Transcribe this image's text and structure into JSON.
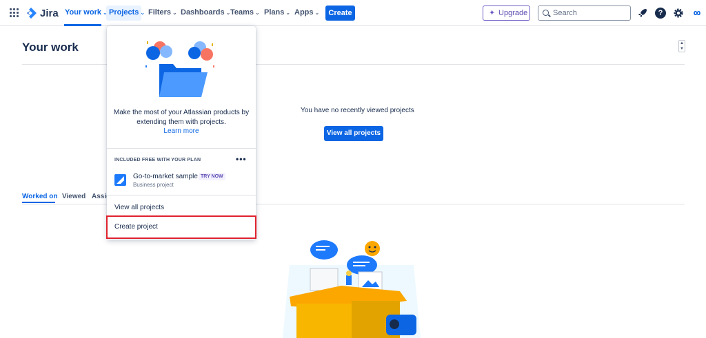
{
  "app": {
    "name": "Jira"
  },
  "nav": {
    "your_work": "Your work",
    "projects": "Projects",
    "filters": "Filters",
    "dashboards": "Dashboards",
    "teams": "Teams",
    "plans": "Plans",
    "apps": "Apps",
    "create": "Create",
    "upgrade": "Upgrade",
    "search_placeholder": "Search",
    "chevron": "⌄"
  },
  "icons": {
    "app_switcher": "grid-icon",
    "logo": "jira-logo-icon",
    "notifications": "rocket-icon",
    "help": "help-icon",
    "settings": "gear-icon",
    "profile": "infinity-icon"
  },
  "colors": {
    "accent": "#0c66e4",
    "upgrade": "#6e5dc6",
    "highlight": "#e0212d"
  },
  "page": {
    "title": "Your work",
    "empty_recent": "You have no recently viewed projects",
    "view_all_projects": "View all projects",
    "tabs": [
      "Worked on",
      "Viewed",
      "Assig"
    ]
  },
  "dropdown": {
    "description": "Make the most of your Atlassian products by extending them with projects.",
    "learn_more": "Learn more",
    "section_label": "INCLUDED FREE WITH YOUR PLAN",
    "more": "•••",
    "sample": {
      "name": "Go-to-market sample",
      "badge": "TRY NOW",
      "type": "Business project"
    },
    "view_all_projects": "View all projects",
    "create_project": "Create project"
  }
}
